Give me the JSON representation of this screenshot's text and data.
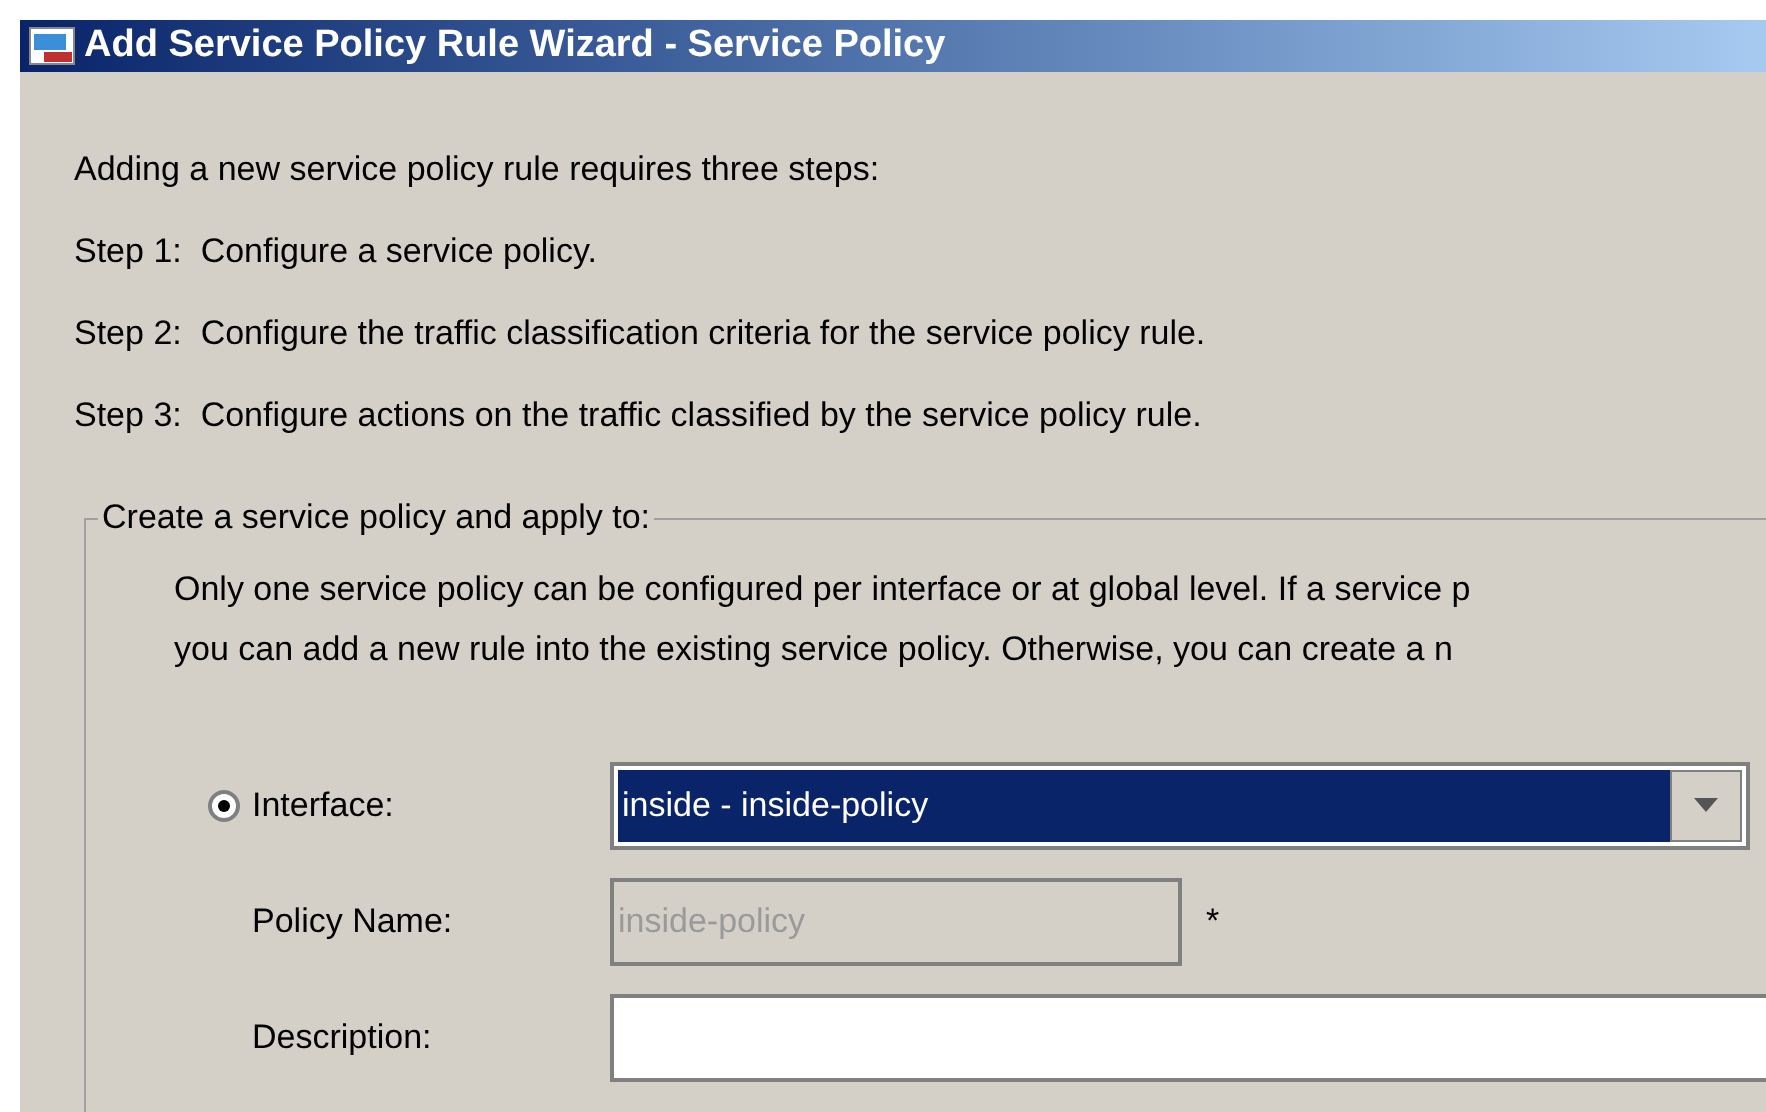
{
  "window": {
    "title": "Add Service Policy Rule Wizard - Service Policy"
  },
  "intro": [
    "Adding a new service policy rule requires three steps:",
    "Step 1:  Configure a service policy.",
    "Step 2:  Configure the traffic classification criteria for the service policy rule.",
    "Step 3:  Configure actions on the traffic classified by the service policy rule."
  ],
  "group": {
    "title": "Create a service policy and apply to:",
    "note": [
      "Only one service policy can be configured per interface or at global level. If a service p",
      "you can add a new rule into the existing service policy. Otherwise, you can create a n"
    ],
    "interface": {
      "label": "Interface:",
      "selected": true,
      "value": "inside - inside-policy"
    },
    "policy_name": {
      "label": "Policy Name:",
      "value": "inside-policy",
      "disabled": true,
      "required_mark": "*"
    },
    "description": {
      "label": "Description:"
    }
  }
}
